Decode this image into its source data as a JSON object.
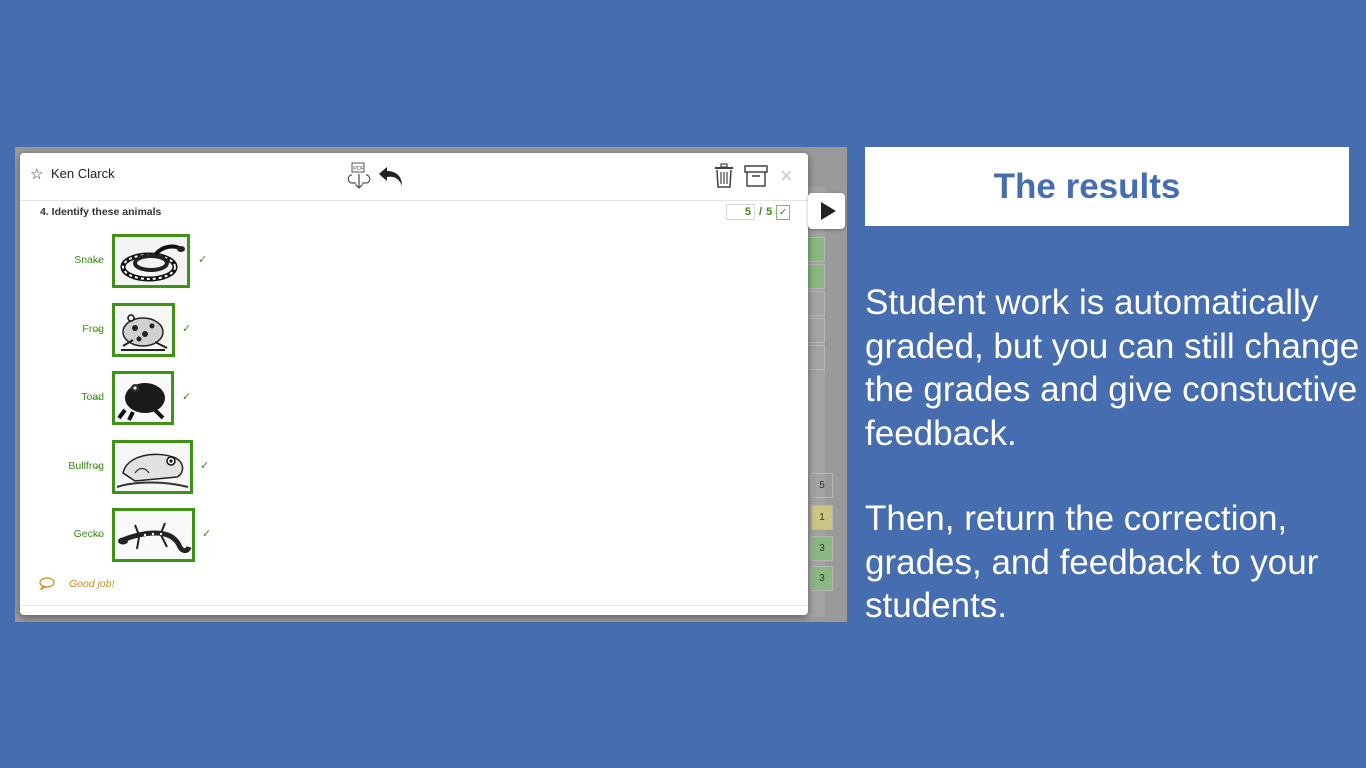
{
  "modal": {
    "student_name": "Ken Clarck",
    "question_title": "4. Identify these animals",
    "score": {
      "value": "5",
      "separator": "/",
      "max": "5"
    },
    "answers": [
      {
        "label": "Snake",
        "correct": true
      },
      {
        "label": "Frog",
        "correct": true
      },
      {
        "label": "Toad",
        "correct": true
      },
      {
        "label": "Bullfrog",
        "correct": true
      },
      {
        "label": "Gecko",
        "correct": true
      }
    ],
    "arrow": "→",
    "check": "✓",
    "feedback": "Good job!",
    "icons": [
      "star-icon",
      "pdf-download-icon",
      "undo-icon",
      "trash-icon",
      "archive-icon",
      "close-icon",
      "comment-icon",
      "play-icon"
    ]
  },
  "background_grid": {
    "values": [
      "5",
      "1",
      "3",
      "3"
    ]
  },
  "panel": {
    "title": "The results",
    "paragraph1": "Student work is automatically graded, but you can still change the grades and give constuctive feedback.",
    "paragraph2": "Then, return the correction, grades, and feedback to your students."
  },
  "colors": {
    "background": "#456daf",
    "correct_green": "#3e9215",
    "feedback_orange": "#c8891a"
  }
}
